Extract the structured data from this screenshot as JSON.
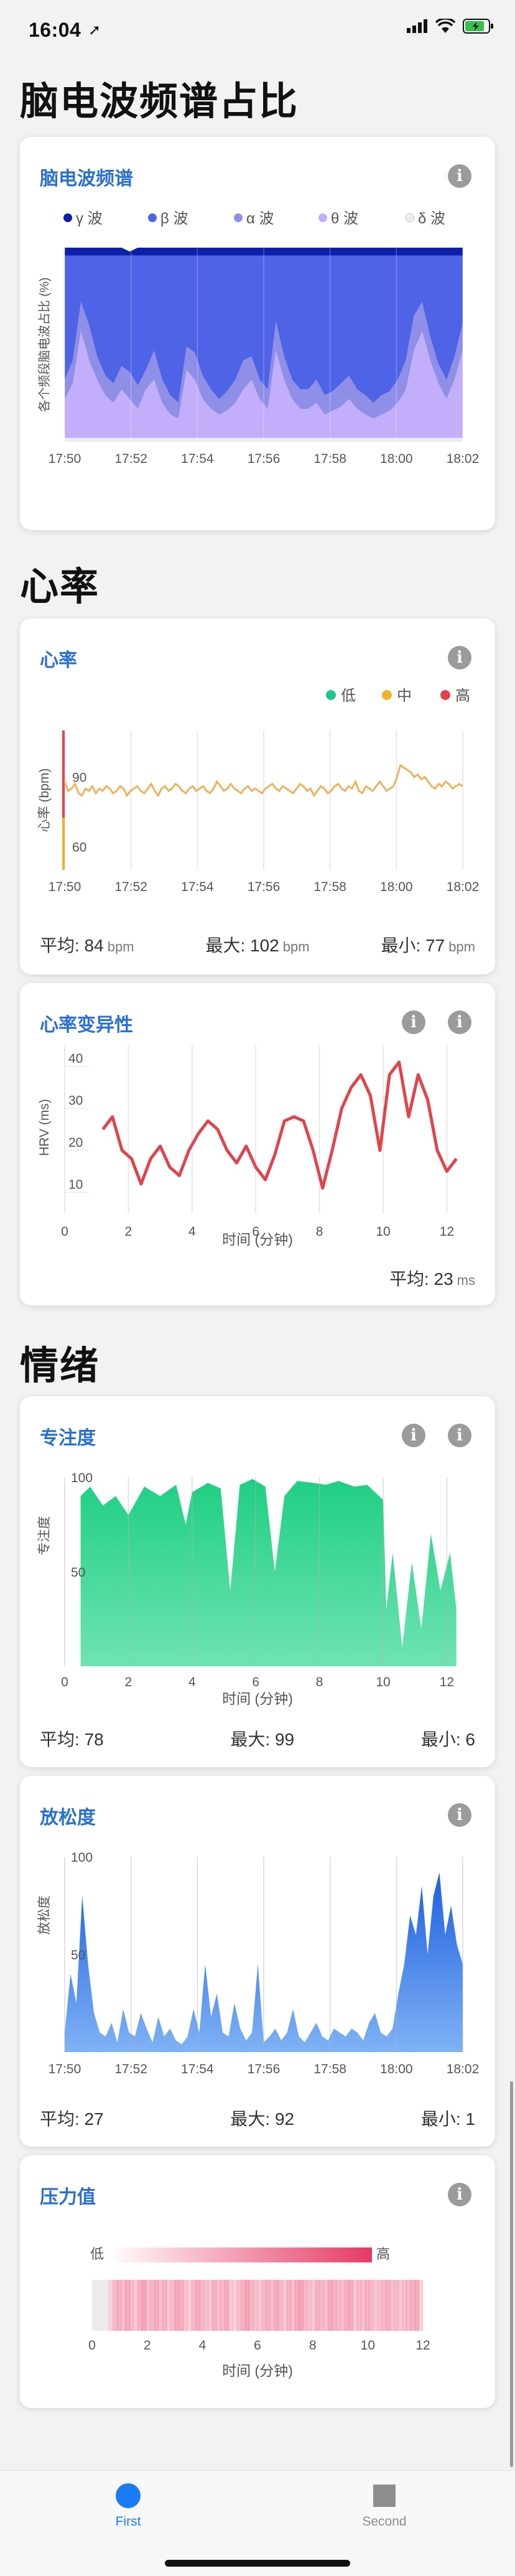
{
  "status_bar": {
    "time": "16:04",
    "location_glyph": "➚"
  },
  "sections": {
    "brainwave": "脑电波频谱占比",
    "heart": "心率",
    "emotion": "情绪"
  },
  "brainwave_card": {
    "title": "脑电波频谱",
    "info": "i",
    "legend": [
      "γ 波",
      "β 波",
      "α 波",
      "θ 波",
      "δ 波"
    ],
    "colors": [
      "#0d1fa8",
      "#4f63e6",
      "#8f8fe8",
      "#c2aefb",
      "#ececec"
    ]
  },
  "heart_rate_card": {
    "title": "心率",
    "info": "i",
    "legend": [
      "低",
      "中",
      "高"
    ],
    "legend_colors": [
      "#1fc58a",
      "#f2b02e",
      "#e0444b"
    ],
    "stats": {
      "avg_label": "平均: 84",
      "max_label": "最大: 102",
      "min_label": "最小: 77",
      "unit": "bpm"
    }
  },
  "hrv_card": {
    "title": "心率变异性",
    "info": "i",
    "stats": {
      "avg_label": "平均: 23",
      "unit": "ms"
    }
  },
  "focus_card": {
    "title": "专注度",
    "info": "i",
    "stats": {
      "avg": "平均: 78",
      "max": "最大: 99",
      "min": "最小: 6"
    }
  },
  "relax_card": {
    "title": "放松度",
    "info": "i",
    "stats": {
      "avg": "平均: 27",
      "max": "最大: 92",
      "min": "最小: 1"
    }
  },
  "stress_card": {
    "title": "压力值",
    "info": "i",
    "scale_low": "低",
    "scale_high": "高",
    "xlabel": "时间 (分钟)",
    "xticks": [
      "0",
      "2",
      "4",
      "6",
      "8",
      "10",
      "12"
    ],
    "band_intensities": [
      0.0,
      0.0,
      0.0,
      0.0,
      0.35,
      0.5,
      0.55,
      0.45,
      0.6,
      0.5,
      0.4,
      0.55,
      0.65,
      0.45,
      0.5,
      0.6,
      0.45,
      0.55,
      0.4,
      0.5,
      0.6,
      0.55,
      0.45,
      0.35,
      0.5,
      0.6,
      0.5,
      0.45,
      0.4,
      0.55,
      0.45,
      0.5,
      0.6,
      0.4,
      0.35,
      0.45,
      0.55,
      0.65,
      0.5,
      0.45,
      0.4,
      0.5,
      0.55,
      0.45,
      0.6,
      0.5,
      0.4,
      0.55,
      0.45,
      0.6,
      0.65,
      0.5,
      0.45,
      0.4,
      0.55,
      0.5,
      0.45,
      0.6,
      0.55,
      0.5,
      0.45,
      0.55,
      0.6,
      0.4,
      0.5,
      0.45,
      0.55,
      0.5,
      0.4,
      0.45,
      0.5,
      0.55,
      0.45,
      0.5,
      0.4,
      0.45,
      0.5,
      0.55,
      0.6,
      0.35
    ]
  },
  "chart_data": [
    {
      "type": "area",
      "title": "脑电波频谱",
      "ylabel": "各个频段脑电波占比 (%)",
      "x_ticks": [
        "17:50",
        "17:52",
        "17:54",
        "17:56",
        "17:58",
        "18:00",
        "18:02"
      ],
      "ylim": [
        0,
        100
      ],
      "series": [
        {
          "name": "δ 波",
          "values": [
            2,
            2,
            2,
            2,
            2,
            2,
            2,
            2,
            2,
            2,
            2,
            2,
            2,
            2,
            2,
            2,
            2,
            2,
            2,
            2,
            2,
            2,
            2,
            2,
            2,
            2,
            2,
            2,
            2,
            2,
            2,
            2,
            2,
            2,
            2,
            2,
            2,
            2,
            2,
            2,
            2,
            2,
            2,
            2,
            2,
            2,
            2,
            2,
            2,
            2
          ]
        },
        {
          "name": "θ 波",
          "values": [
            20,
            28,
            55,
            40,
            30,
            22,
            18,
            25,
            20,
            15,
            25,
            30,
            18,
            12,
            10,
            35,
            30,
            20,
            15,
            12,
            14,
            18,
            25,
            30,
            20,
            15,
            45,
            30,
            20,
            15,
            15,
            18,
            12,
            14,
            16,
            20,
            15,
            12,
            10,
            12,
            14,
            18,
            25,
            45,
            55,
            40,
            28,
            20,
            30,
            45
          ]
        },
        {
          "name": "α 波",
          "values": [
            10,
            12,
            15,
            18,
            12,
            10,
            10,
            12,
            14,
            12,
            10,
            15,
            12,
            10,
            8,
            12,
            14,
            12,
            10,
            8,
            10,
            12,
            15,
            12,
            10,
            10,
            15,
            12,
            10,
            10,
            10,
            12,
            10,
            10,
            12,
            12,
            10,
            10,
            8,
            10,
            10,
            12,
            15,
            18,
            15,
            12,
            10,
            10,
            12,
            14
          ]
        },
        {
          "name": "β 波",
          "values": [
            64,
            54,
            24,
            36,
            52,
            62,
            66,
            57,
            60,
            67,
            59,
            49,
            64,
            72,
            76,
            47,
            50,
            62,
            69,
            74,
            70,
            64,
            54,
            52,
            64,
            69,
            34,
            52,
            64,
            69,
            69,
            64,
            72,
            70,
            66,
            62,
            69,
            72,
            76,
            72,
            70,
            64,
            54,
            31,
            24,
            42,
            56,
            64,
            52,
            35
          ]
        },
        {
          "name": "γ 波",
          "values": [
            4,
            4,
            4,
            4,
            4,
            4,
            4,
            4,
            2,
            4,
            4,
            4,
            4,
            4,
            4,
            4,
            4,
            4,
            4,
            4,
            4,
            4,
            4,
            4,
            4,
            4,
            4,
            4,
            4,
            4,
            4,
            4,
            4,
            4,
            4,
            4,
            4,
            4,
            4,
            4,
            4,
            4,
            4,
            4,
            4,
            4,
            4,
            4,
            4,
            4
          ]
        }
      ]
    },
    {
      "type": "line",
      "title": "心率",
      "ylabel": "心率 (bpm)",
      "x_ticks": [
        "17:50",
        "17:52",
        "17:54",
        "17:56",
        "17:58",
        "18:00",
        "18:02"
      ],
      "y_ticks": [
        60,
        90
      ],
      "ylim": [
        50,
        110
      ],
      "series": [
        {
          "name": "心率",
          "values": [
            88,
            84,
            85,
            87,
            83,
            82,
            85,
            84,
            86,
            83,
            85,
            84,
            86,
            85,
            83,
            84,
            86,
            85,
            82,
            84,
            85,
            86,
            84,
            83,
            85,
            87,
            84,
            82,
            85,
            86,
            84,
            85,
            87,
            86,
            84,
            83,
            85,
            86,
            84,
            85,
            86,
            84,
            83,
            85,
            88,
            86,
            84,
            85,
            87,
            85,
            84,
            83,
            85,
            86,
            84,
            85,
            84,
            83,
            85,
            86,
            87,
            85,
            84,
            86,
            85,
            84,
            83,
            85,
            87,
            86,
            84,
            85,
            82,
            84,
            86,
            85,
            83,
            84,
            86,
            87,
            85,
            84,
            86,
            85,
            88,
            84,
            83,
            86,
            85,
            84,
            86,
            88,
            86,
            84,
            85,
            86,
            90,
            95,
            94,
            93,
            92,
            90,
            91,
            89,
            90,
            88,
            86,
            85,
            87,
            86,
            88,
            87,
            85,
            86,
            87,
            86
          ]
        }
      ]
    },
    {
      "type": "line",
      "title": "心率变异性",
      "xlabel": "时间 (分钟)",
      "ylabel": "HRV (ms)",
      "x_ticks": [
        0,
        2,
        4,
        6,
        8,
        10,
        12
      ],
      "y_ticks": [
        10,
        20,
        30,
        40
      ],
      "xlim": [
        0,
        12.5
      ],
      "ylim": [
        5,
        45
      ],
      "series": [
        {
          "name": "HRV",
          "values": [
            [
              1.2,
              25
            ],
            [
              1.5,
              28
            ],
            [
              1.8,
              20
            ],
            [
              2.1,
              18
            ],
            [
              2.4,
              12
            ],
            [
              2.7,
              18
            ],
            [
              3.0,
              21
            ],
            [
              3.3,
              16
            ],
            [
              3.6,
              14
            ],
            [
              3.9,
              20
            ],
            [
              4.2,
              24
            ],
            [
              4.5,
              27
            ],
            [
              4.8,
              25
            ],
            [
              5.1,
              20
            ],
            [
              5.4,
              17
            ],
            [
              5.7,
              21
            ],
            [
              6.0,
              16
            ],
            [
              6.3,
              13
            ],
            [
              6.6,
              19
            ],
            [
              6.9,
              27
            ],
            [
              7.2,
              28
            ],
            [
              7.5,
              27
            ],
            [
              7.8,
              20
            ],
            [
              8.1,
              11
            ],
            [
              8.4,
              20
            ],
            [
              8.7,
              30
            ],
            [
              9.0,
              35
            ],
            [
              9.3,
              38
            ],
            [
              9.6,
              33
            ],
            [
              9.9,
              20
            ],
            [
              10.2,
              38
            ],
            [
              10.5,
              41
            ],
            [
              10.8,
              28
            ],
            [
              11.1,
              38
            ],
            [
              11.4,
              32
            ],
            [
              11.7,
              20
            ],
            [
              12.0,
              15
            ],
            [
              12.3,
              18
            ]
          ]
        }
      ]
    },
    {
      "type": "area",
      "title": "专注度",
      "xlabel": "时间 (分钟)",
      "ylabel": "专注度",
      "x_ticks": [
        0,
        2,
        4,
        6,
        8,
        10,
        12
      ],
      "y_ticks": [
        50,
        100
      ],
      "xlim": [
        0,
        12.5
      ],
      "ylim": [
        0,
        100
      ],
      "series": [
        {
          "name": "专注度",
          "values": [
            [
              0.5,
              90
            ],
            [
              0.8,
              95
            ],
            [
              1.2,
              85
            ],
            [
              1.6,
              90
            ],
            [
              2.0,
              80
            ],
            [
              2.5,
              95
            ],
            [
              3.0,
              90
            ],
            [
              3.5,
              96
            ],
            [
              3.8,
              75
            ],
            [
              4.0,
              92
            ],
            [
              4.5,
              97
            ],
            [
              4.9,
              94
            ],
            [
              5.2,
              40
            ],
            [
              5.5,
              96
            ],
            [
              5.9,
              99
            ],
            [
              6.3,
              95
            ],
            [
              6.6,
              50
            ],
            [
              6.9,
              90
            ],
            [
              7.3,
              98
            ],
            [
              7.8,
              97
            ],
            [
              8.2,
              96
            ],
            [
              8.6,
              98
            ],
            [
              9.1,
              95
            ],
            [
              9.5,
              96
            ],
            [
              10.0,
              88
            ],
            [
              10.1,
              30
            ],
            [
              10.3,
              60
            ],
            [
              10.6,
              10
            ],
            [
              10.9,
              55
            ],
            [
              11.2,
              20
            ],
            [
              11.5,
              70
            ],
            [
              11.8,
              40
            ],
            [
              12.1,
              60
            ],
            [
              12.3,
              30
            ]
          ]
        }
      ]
    },
    {
      "type": "area",
      "title": "放松度",
      "ylabel": "放松度",
      "x_ticks": [
        "17:50",
        "17:52",
        "17:54",
        "17:56",
        "17:58",
        "18:00",
        "18:02"
      ],
      "y_ticks": [
        50,
        100
      ],
      "ylim": [
        0,
        100
      ],
      "series": [
        {
          "name": "放松度",
          "values": [
            10,
            40,
            25,
            80,
            45,
            20,
            10,
            8,
            15,
            5,
            22,
            10,
            8,
            20,
            12,
            5,
            18,
            8,
            12,
            6,
            4,
            8,
            22,
            10,
            45,
            18,
            30,
            10,
            8,
            25,
            12,
            6,
            10,
            45,
            5,
            8,
            12,
            6,
            10,
            22,
            8,
            5,
            10,
            15,
            8,
            6,
            12,
            10,
            8,
            12,
            10,
            6,
            15,
            20,
            10,
            8,
            12,
            30,
            45,
            70,
            60,
            85,
            50,
            80,
            92,
            60,
            75,
            55,
            45
          ]
        }
      ]
    }
  ],
  "tab_bar": {
    "tab1": "First",
    "tab2": "Second",
    "tab1_color": "#1a7cf5",
    "tab2_color": "#8e8e8e"
  }
}
